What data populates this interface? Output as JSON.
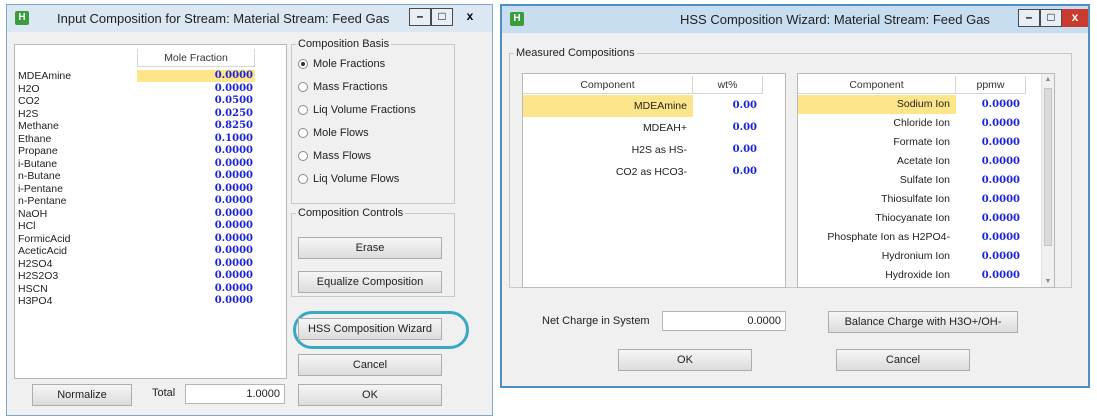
{
  "window1": {
    "title": "Input Composition for Stream: Material Stream: Feed Gas",
    "app_icon": "H",
    "controls": {
      "minimize": "–",
      "maximize": "□",
      "close": "x"
    },
    "grid": {
      "column_header": "Mole Fraction",
      "rows": [
        {
          "name": "MDEAmine",
          "value": "0.0000"
        },
        {
          "name": "H2O",
          "value": "0.0000"
        },
        {
          "name": "CO2",
          "value": "0.0500"
        },
        {
          "name": "H2S",
          "value": "0.0250"
        },
        {
          "name": "Methane",
          "value": "0.8250"
        },
        {
          "name": "Ethane",
          "value": "0.1000"
        },
        {
          "name": "Propane",
          "value": "0.0000"
        },
        {
          "name": "i-Butane",
          "value": "0.0000"
        },
        {
          "name": "n-Butane",
          "value": "0.0000"
        },
        {
          "name": "i-Pentane",
          "value": "0.0000"
        },
        {
          "name": "n-Pentane",
          "value": "0.0000"
        },
        {
          "name": "NaOH",
          "value": "0.0000"
        },
        {
          "name": "HCl",
          "value": "0.0000"
        },
        {
          "name": "FormicAcid",
          "value": "0.0000"
        },
        {
          "name": "AceticAcid",
          "value": "0.0000"
        },
        {
          "name": "H2SO4",
          "value": "0.0000"
        },
        {
          "name": "H2S2O3",
          "value": "0.0000"
        },
        {
          "name": "HSCN",
          "value": "0.0000"
        },
        {
          "name": "H3PO4",
          "value": "0.0000"
        }
      ]
    },
    "composition_basis": {
      "legend": "Composition Basis",
      "options": [
        "Mole Fractions",
        "Mass Fractions",
        "Liq Volume Fractions",
        "Mole Flows",
        "Mass Flows",
        "Liq Volume Flows"
      ],
      "selected": "Mole Fractions"
    },
    "composition_controls": {
      "legend": "Composition Controls",
      "erase": "Erase",
      "equalize": "Equalize Composition"
    },
    "hss_wizard_button": "HSS Composition Wizard",
    "cancel_button": "Cancel",
    "ok_button": "OK",
    "normalize_button": "Normalize",
    "total_label": "Total",
    "total_value": "1.0000"
  },
  "window2": {
    "title": "HSS Composition Wizard: Material Stream: Feed Gas",
    "app_icon": "H",
    "controls": {
      "minimize": "–",
      "maximize": "□",
      "close": "x"
    },
    "group_legend": "Measured Compositions",
    "left_grid": {
      "headers": [
        "Component",
        "wt%"
      ],
      "rows": [
        {
          "name": "MDEAmine",
          "value": "0.00"
        },
        {
          "name": "MDEAH+",
          "value": "0.00"
        },
        {
          "name": "H2S as HS-",
          "value": "0.00"
        },
        {
          "name": "CO2 as HCO3-",
          "value": "0.00"
        }
      ]
    },
    "right_grid": {
      "headers": [
        "Component",
        "ppmw"
      ],
      "rows": [
        {
          "name": "Sodium Ion",
          "value": "0.0000"
        },
        {
          "name": "Chloride Ion",
          "value": "0.0000"
        },
        {
          "name": "Formate Ion",
          "value": "0.0000"
        },
        {
          "name": "Acetate Ion",
          "value": "0.0000"
        },
        {
          "name": "Sulfate Ion",
          "value": "0.0000"
        },
        {
          "name": "Thiosulfate Ion",
          "value": "0.0000"
        },
        {
          "name": "Thiocyanate Ion",
          "value": "0.0000"
        },
        {
          "name": "Phosphate Ion as H2PO4-",
          "value": "0.0000"
        },
        {
          "name": "Hydronium Ion",
          "value": "0.0000"
        },
        {
          "name": "Hydroxide Ion",
          "value": "0.0000"
        }
      ]
    },
    "net_charge_label": "Net Charge in System",
    "net_charge_value": "0.0000",
    "balance_button": "Balance Charge with H3O+/OH-",
    "ok_button": "OK",
    "cancel_button": "Cancel"
  },
  "colors": {
    "value_text": "#1a23d6",
    "selection": "#fde58a",
    "highlight_ring": "#38a8c4",
    "title_bar": "#dbe8f3"
  }
}
